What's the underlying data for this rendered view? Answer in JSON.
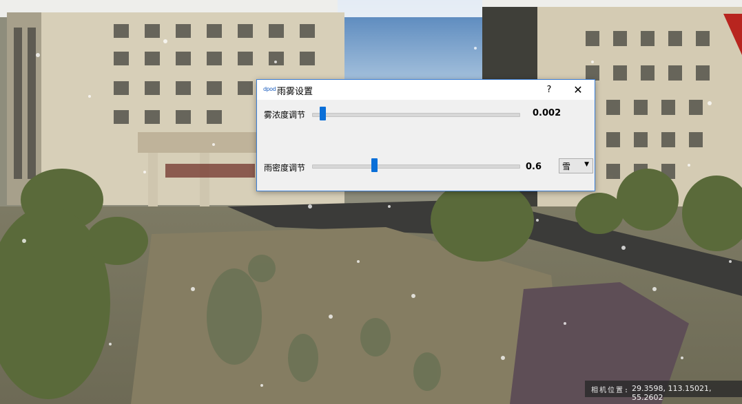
{
  "dialog": {
    "icon_text": "dpod",
    "title": "雨雾设置",
    "help_label": "?",
    "close_label": "✕",
    "fog": {
      "label": "雾浓度调节",
      "value_text": "0.002",
      "slider_fraction": 0.05
    },
    "rain": {
      "label": "雨密度调节",
      "value_text": "0.6",
      "slider_fraction": 0.3
    },
    "weather_select": {
      "selected": "雪",
      "arrow": "▼"
    }
  },
  "status": {
    "camera_label": "相机位置:",
    "camera_value": "29.3598, 113.15021, 55.2602"
  },
  "colors": {
    "accent": "#0a6fd8",
    "dialog_border": "#3c7fd6",
    "dialog_bg": "#f0f0f0"
  },
  "icons": {
    "close": "close-icon",
    "help": "help-icon",
    "dropdown": "chevron-down-icon"
  }
}
